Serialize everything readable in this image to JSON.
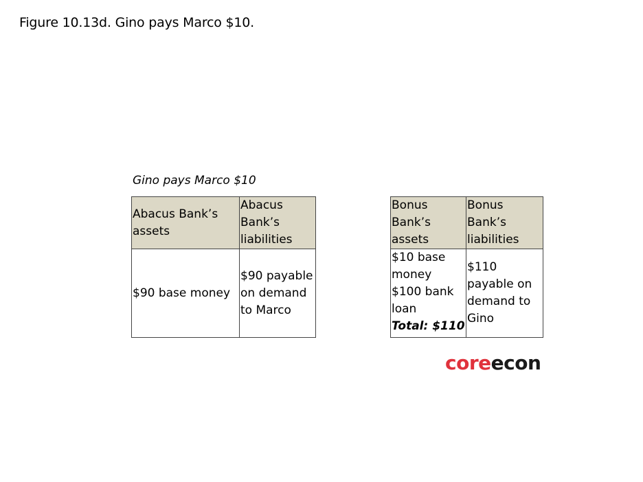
{
  "figure_title": "Figure 10.13d. Gino pays Marco $10.",
  "caption": "Gino pays Marco $10",
  "abacus": {
    "assets_header": "Abacus Bank’s assets",
    "liabilities_header": "Abacus Bank’s liabilities",
    "assets": "$90 base money",
    "liabilities": "$90 payable on demand to Marco"
  },
  "bonus": {
    "assets_header": "Bonus Bank’s assets",
    "liabilities_header": "Bonus Bank’s liabilities",
    "assets_line1": "$10 base money",
    "assets_line2": "$100 bank loan",
    "assets_total": "Total: $110",
    "liabilities": "$110 payable on demand to Gino"
  },
  "logo": {
    "part1": "core",
    "part2": "econ",
    "accent_color": "#e0323c"
  }
}
